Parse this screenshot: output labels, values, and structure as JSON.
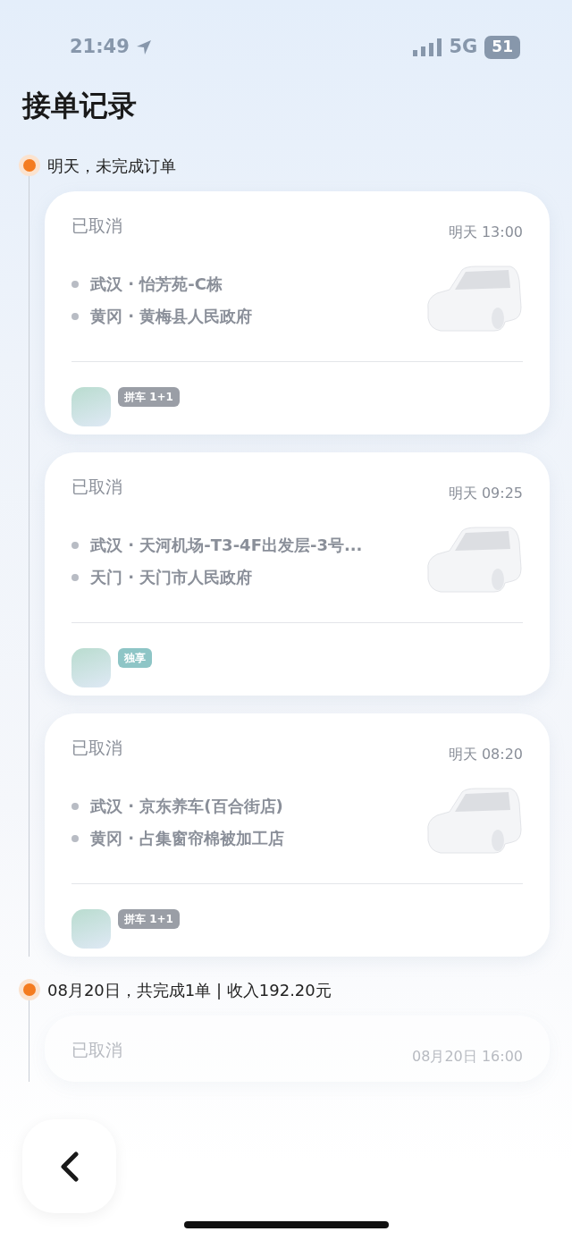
{
  "status_bar": {
    "time": "21:49",
    "network": "5G",
    "battery": "51"
  },
  "title": "接单记录",
  "groups": [
    {
      "header": "明天，未完成订单",
      "orders": [
        {
          "status": "已取消",
          "time": "明天 13:00",
          "stops": [
            "武汉 · 怡芳苑-C栋",
            "黄冈 · 黄梅县人民政府"
          ],
          "tag": {
            "label": "拼车 1+1",
            "color": "#9a9ea6"
          }
        },
        {
          "status": "已取消",
          "time": "明天 09:25",
          "stops": [
            "武汉 · 天河机场-T3-4F出发层-3号...",
            "天门 · 天门市人民政府"
          ],
          "tag": {
            "label": "独享",
            "color": "#8ec5c6"
          }
        },
        {
          "status": "已取消",
          "time": "明天 08:20",
          "stops": [
            "武汉 · 京东养车(百合街店)",
            "黄冈 · 占集窗帘棉被加工店"
          ],
          "tag": {
            "label": "拼车 1+1",
            "color": "#9a9ea6"
          }
        }
      ]
    },
    {
      "header": "08月20日，共完成1单 | 收入192.20元",
      "orders": [
        {
          "status": "已取消",
          "time": "08月20日 16:00"
        }
      ]
    }
  ]
}
